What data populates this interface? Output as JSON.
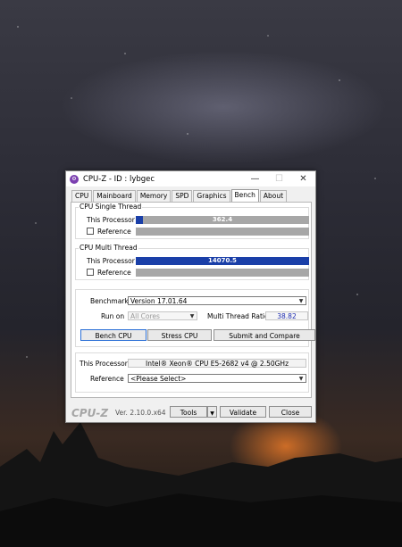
{
  "window": {
    "title": "CPU-Z - ID : lybgec",
    "minimize_glyph": "—",
    "maximize_glyph": "☐",
    "close_glyph": "✕"
  },
  "tabs": [
    {
      "label": "CPU"
    },
    {
      "label": "Mainboard"
    },
    {
      "label": "Memory"
    },
    {
      "label": "SPD"
    },
    {
      "label": "Graphics"
    },
    {
      "label": "Bench"
    },
    {
      "label": "About"
    }
  ],
  "single_thread": {
    "title": "CPU Single Thread",
    "this_label": "This Processor",
    "this_value": "362.4",
    "this_fraction": 0.04,
    "ref_label": "Reference"
  },
  "multi_thread": {
    "title": "CPU Multi Thread",
    "this_label": "This Processor",
    "this_value": "14070.5",
    "this_fraction": 1.0,
    "ref_label": "Reference"
  },
  "bench": {
    "benchmark_label": "Benchmark",
    "benchmark_value": "Version 17.01.64",
    "runon_label": "Run on",
    "runon_value": "All Cores",
    "ratio_label": "Multi Thread Ratio",
    "ratio_value": "38.82",
    "bench_cpu": "Bench CPU",
    "stress_cpu": "Stress CPU",
    "submit": "Submit and Compare"
  },
  "processor": {
    "this_label": "This Processor",
    "this_value": "Intel® Xeon® CPU E5-2682 v4 @ 2.50GHz",
    "ref_label": "Reference",
    "ref_value": "<Please Select>"
  },
  "footer": {
    "logo": "CPU-Z",
    "version": "Ver. 2.10.0.x64",
    "tools": "Tools",
    "validate": "Validate",
    "close": "Close"
  },
  "colors": {
    "bar_fill": "#1a3fa8",
    "bar_bg": "#a7a7a7",
    "ratio_text": "#1e2db0"
  }
}
